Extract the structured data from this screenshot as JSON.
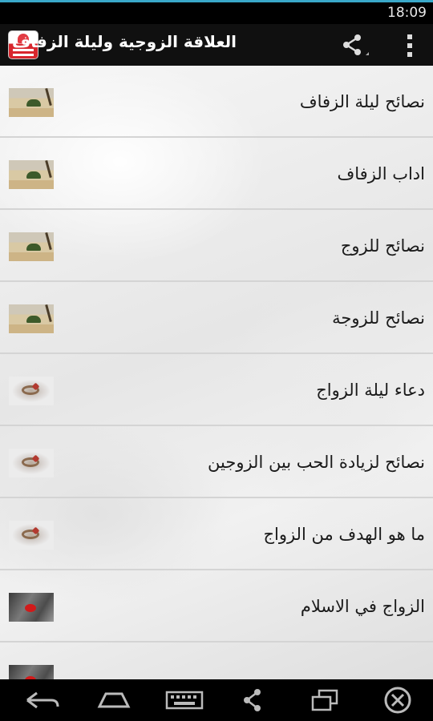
{
  "status_bar": {
    "time": "18:09"
  },
  "action_bar": {
    "title": "العلاقة الزوجية وليلة الزفاف",
    "share_icon": "share-icon",
    "overflow_icon": "overflow-menu-icon"
  },
  "list": {
    "items": [
      {
        "label": "نصائح ليلة الزفاف",
        "thumb": "beach"
      },
      {
        "label": "اداب الزفاف",
        "thumb": "beach"
      },
      {
        "label": "نصائح للزوج",
        "thumb": "beach"
      },
      {
        "label": "نصائح للزوجة",
        "thumb": "beach"
      },
      {
        "label": "دعاء ليلة الزواج",
        "thumb": "ring"
      },
      {
        "label": "نصائح لزيادة الحب بين الزوجين",
        "thumb": "ring"
      },
      {
        "label": "ما هو الهدف من الزواج",
        "thumb": "ring"
      },
      {
        "label": "الزواج في الاسلام",
        "thumb": "rose"
      }
    ]
  },
  "nav_bar": {
    "buttons": [
      "back-icon",
      "home-icon",
      "keyboard-icon",
      "share-icon",
      "recent-apps-icon",
      "close-icon"
    ]
  },
  "colors": {
    "status_accent": "#3aa8c9",
    "action_bar_bg": "#101010",
    "divider": "#d4d4d4",
    "text": "#1a1a1a"
  }
}
